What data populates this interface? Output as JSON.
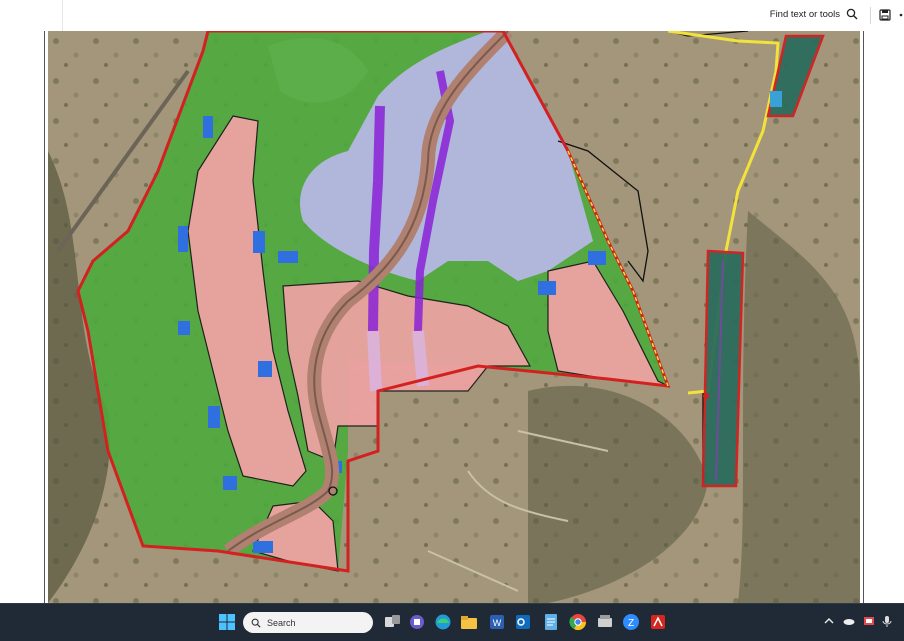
{
  "toolbar": {
    "find_label": "Find text or tools",
    "icons": [
      "search-icon",
      "save-icon",
      "more-icon"
    ]
  },
  "taskbar": {
    "search_placeholder": "Search",
    "apps": [
      "start-icon",
      "search-icon",
      "task-view-icon",
      "teams-icon",
      "edge-icon",
      "file-explorer-icon",
      "word-icon",
      "outlook-icon",
      "notepad-icon",
      "chrome-icon",
      "scanner-icon",
      "zoom-icon",
      "acrobat-icon"
    ],
    "tray": [
      "chevron-up-icon",
      "onedrive-icon",
      "app-tray-icon",
      "microphone-icon"
    ]
  },
  "colors": {
    "boundary_red": "#d32020",
    "vegetation_green": "#4caa3c",
    "development_pink": "#eea2a2",
    "water_blue": "#2f6fe0",
    "lavender_zone": "#b9b8e8",
    "purple_line": "#8a22d6",
    "easement_yellow": "#f2e23a",
    "teal_strip": "#2d6c5c"
  }
}
